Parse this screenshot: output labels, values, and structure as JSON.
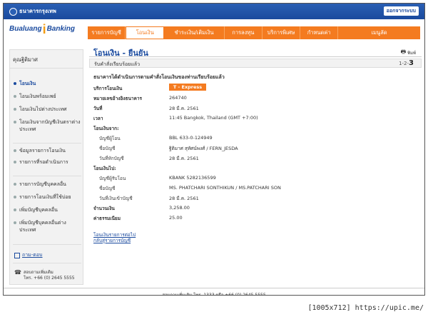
{
  "topbar": {
    "bank_name": "ธนาคารกรุงเทพ",
    "logout_label": "ออกจากระบบ"
  },
  "brand": {
    "part1": "Bualuang",
    "part2": "i",
    "part3": "Banking"
  },
  "nav": [
    "รายการบัญชี",
    "โอนเงิน",
    "ชำระเงิน/เติมเงิน",
    "การลงทุน",
    "บริการพิเศษ",
    "กำหนดค่า",
    "เมนูลัด"
  ],
  "sidebar": {
    "user_label": "คุณฐิติมาศ",
    "items": [
      "โอนเงิน",
      "โอนเงินพร้อมเพย์",
      "โอนเงินไปต่างประเทศ",
      "โอนเงินจากบัญชีเงินตราต่างประเทศ",
      "ข้อมูลรายการโอนเงิน",
      "รายการที่รอดำเนินการ",
      "รายการบัญชีบุคคลอื่น",
      "รายการโอนเงินที่ใช้บ่อย",
      "เพิ่มบัญชีบุคคลอื่น",
      "เพิ่มบัญชีบุคคลอื่นต่างประเทศ"
    ],
    "help_label": "ถาม-ตอบ",
    "contact_line1": "สอบถามเพิ่มเติม",
    "contact_line2": "โทร. +66 (0) 2645 5555"
  },
  "main": {
    "title": "โอนเงิน - ยืนยัน",
    "print_label": "พิมพ์",
    "status": "รับคำสั่งเรียบร้อยแล้ว",
    "steps_prefix": "1-2-",
    "steps_current": "3",
    "intro": "ธนาคารได้ดำเนินการตามคำสั่งโอนเงินของท่านเรียบร้อยแล้ว",
    "service_label": "บริการโอนเงิน",
    "service_value": "T - Express",
    "ref_label": "หมายเลขอ้างอิงธนาคาร",
    "ref_value": "264740",
    "date_label": "วันที่",
    "date_value": "28 มี.ค. 2561",
    "time_label": "เวลา",
    "time_value": "11:45 Bangkok, Thailand (GMT +7:00)",
    "from_heading": "โอนเงินจาก:",
    "from_acct_label": "บัญชีผู้โอน",
    "from_acct_value": "BBL 633-0-124949",
    "from_name_label": "ชื่อบัญชี",
    "from_name_value": "ฐิติมาศ สุทัศน์พงศ์ / FERN_JESDA",
    "from_date_label": "วันที่หักบัญชี",
    "from_date_value": "28 มี.ค. 2561",
    "to_heading": "โอนเงินไป:",
    "to_acct_label": "บัญชีผู้รับโอน",
    "to_acct_value": "KBANK 5282136599",
    "to_name_label": "ชื่อบัญชี",
    "to_name_value": "MS. PHATCHARI SONTHIKUN / MS.PATCHARI SON",
    "to_date_label": "วันที่เงินเข้าบัญชี",
    "to_date_value": "28 มี.ค. 2561",
    "amount_label": "จำนวนเงิน",
    "amount_value": "3,258.00",
    "fee_label": "ค่าธรรมเนียม",
    "fee_value": "25.00",
    "link1": "โอนเงินรายการต่อไป",
    "link2": "กลับสู่รายการบัญชี"
  },
  "footer": "สอบถามเพิ่มเติม โทร. 1333 หรือ +66 (0) 2645 5555",
  "caption": "[1005x712] https://upic.me/"
}
